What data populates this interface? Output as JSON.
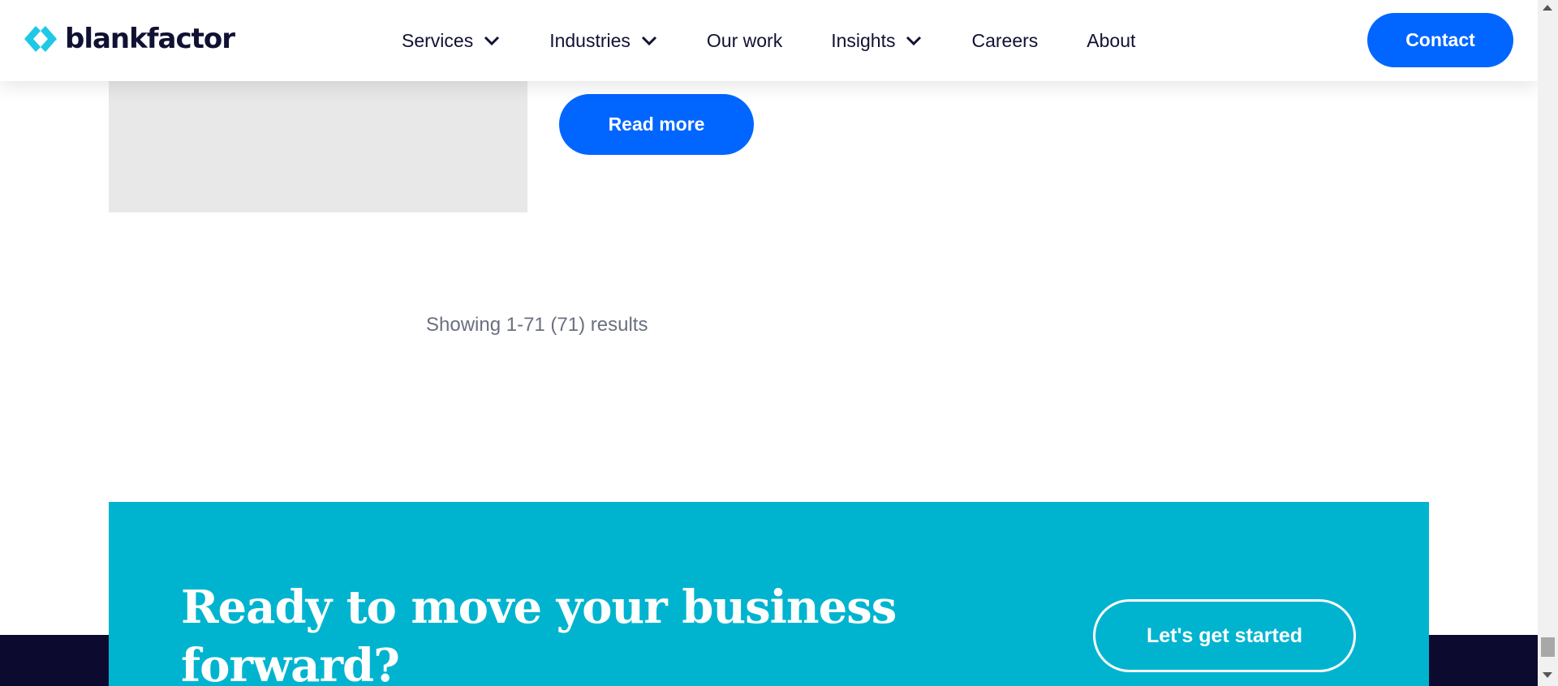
{
  "header": {
    "logo_text": "blankfactor",
    "logo_icon": "blankfactor-brackets-logo",
    "nav": [
      {
        "label": "Services",
        "has_dropdown": true
      },
      {
        "label": "Industries",
        "has_dropdown": true
      },
      {
        "label": "Our work",
        "has_dropdown": false
      },
      {
        "label": "Insights",
        "has_dropdown": true
      },
      {
        "label": "Careers",
        "has_dropdown": false
      },
      {
        "label": "About",
        "has_dropdown": false
      }
    ],
    "contact_label": "Contact"
  },
  "main": {
    "read_more_label": "Read more",
    "results_text": "Showing 1-71 (71) results"
  },
  "cta": {
    "title": "Ready to move your business forward?",
    "button_label": "Let's get started"
  },
  "colors": {
    "primary_blue": "#0066ff",
    "cta_cyan": "#00b4d0",
    "footer_navy": "#0c0a2e",
    "logo_cyan": "#1ec8e6",
    "image_placeholder": "#e8e8e8"
  }
}
